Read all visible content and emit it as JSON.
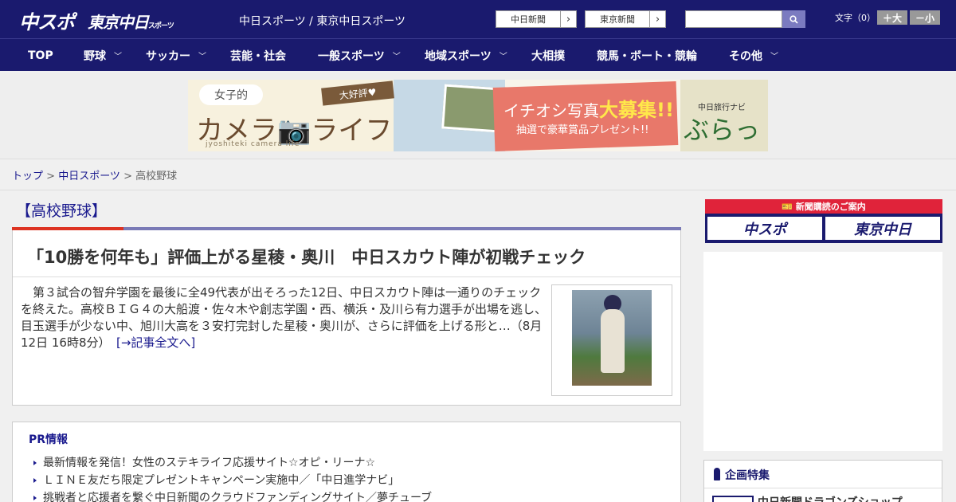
{
  "header": {
    "logo_chuspo": "中スポ",
    "logo_tokyo": "東京中日",
    "logo_tokyo_small": "スポーツ",
    "site_names": "中日スポーツ / 東京中日スポーツ",
    "link_chunichi": "中日新聞",
    "link_tokyo": "東京新聞",
    "text_size_label": "文字（0）",
    "size_up": "＋大",
    "size_down": "－小"
  },
  "nav": {
    "items": [
      {
        "label": "TOP"
      },
      {
        "label": "野球",
        "has_menu": true
      },
      {
        "label": "サッカー",
        "has_menu": true
      },
      {
        "label": "芸能・社会"
      },
      {
        "label": "一般スポーツ",
        "has_menu": true
      },
      {
        "label": "地域スポーツ",
        "has_menu": true
      },
      {
        "label": "大相撲"
      },
      {
        "label": "競馬・ボート・競輪"
      },
      {
        "label": "その他",
        "has_menu": true
      }
    ]
  },
  "banner": {
    "joshi": "女子的",
    "camera": "カメラ📷ライフ",
    "sub": "jyoshiteki camera life",
    "ribbon": "大好評♥",
    "promo_line1_a": "イチオシ写真",
    "promo_line1_b": "大募集!!",
    "promo_line2": "抽選で豪華賞品プレゼント!!",
    "bura_tag": "中日旅行ナビ",
    "bura_logo": "ぶらっ人"
  },
  "breadcrumb": {
    "top": "トップ",
    "sep": " > ",
    "section": "中日スポーツ",
    "current": "高校野球"
  },
  "category": "【高校野球】",
  "article": {
    "headline": "「10勝を何年も」評価上がる星稜・奥川　中日スカウト陣が初戦チェック",
    "lead": "　第３試合の智弁学園を最後に全49代表が出そろった12日、中日スカウト陣は一通りのチェックを終えた。高校ＢＩＧ４の大船渡・佐々木や創志学園・西、横浜・及川ら有力選手が出場を逃し、目玉選手が少ない中、旭川大高を３安打完封した星稜・奥川が、さらに評価を上げる形と…（8月12日 16時8分）",
    "more": "[→記事全文へ]"
  },
  "pr": {
    "title": "PR情報",
    "items": [
      "最新情報を発信！女性のステキライフ応援サイト☆オピ・リーナ☆",
      "ＬＩＮＥ友だち限定プレゼントキャンペーン実施中／「中日進学ナビ」",
      "挑戦者と応援者を繋ぐ中日新聞のクラウドファンディングサイト／夢チューブ"
    ]
  },
  "sidebar": {
    "subscribe_head": "🎫 新聞購読のご案内",
    "sub_chuspo": "中スポ",
    "sub_tokyo": "東京中日",
    "kikaku_title": "企画特集",
    "kikaku_item": "中日新聞ドラゴンズショップ"
  },
  "colors": {
    "brand_navy": "#1a1a6e",
    "accent_red": "#d32f2f",
    "link_blue": "#1a1a8e"
  },
  "icons": [
    "search-icon",
    "chevron-right-icon",
    "chevron-down-icon",
    "camera-icon",
    "ticket-icon",
    "pin-icon"
  ]
}
